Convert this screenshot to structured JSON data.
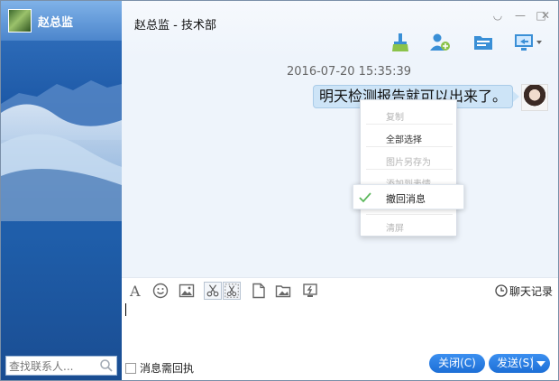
{
  "contact": {
    "name": "赵总监"
  },
  "search": {
    "placeholder": "查找联系人..."
  },
  "chat": {
    "title": "赵总监 - 技术部",
    "timestamp": "2016-07-20 15:35:39",
    "message": "明天检测报告就可以出来了。"
  },
  "context_menu": {
    "items": [
      {
        "label": "复制",
        "enabled": false
      },
      {
        "label": "全部选择",
        "enabled": true
      },
      {
        "label": "图片另存为",
        "enabled": false
      },
      {
        "label": "添加到表情",
        "enabled": false
      },
      {
        "label": "撤回消息",
        "enabled": true,
        "highlighted": true
      },
      {
        "label": "清屏",
        "enabled": false
      }
    ]
  },
  "toolbar": {
    "icons": [
      "font-icon",
      "emoji-icon",
      "image-icon",
      "scissors-icon",
      "screenshot-icon",
      "file-icon",
      "folder-image-icon",
      "shake-icon"
    ],
    "history_label": "聊天记录"
  },
  "footer": {
    "receipt_label": "消息需回执",
    "close_label": "关闭(C)",
    "send_label": "发送(S)"
  },
  "colors": {
    "accent": "#1d6fd6",
    "bubble": "#cde4f7",
    "sidebar": "#1f5eaa"
  }
}
